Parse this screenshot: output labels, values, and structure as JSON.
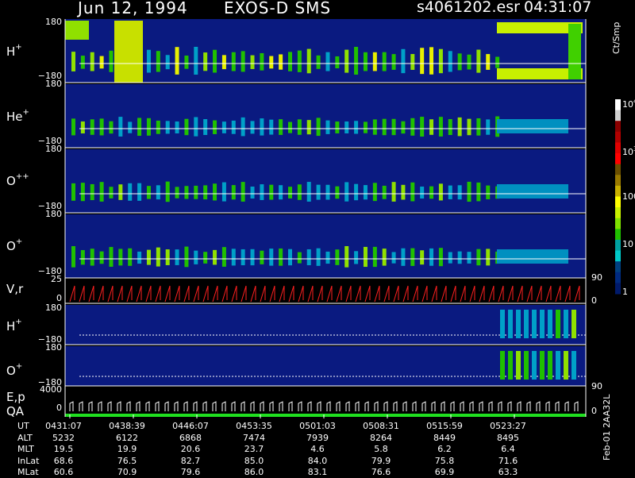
{
  "header": {
    "date": "Jun 12, 1994",
    "instrument": "EXOS-D SMS",
    "file": "s4061202.esr",
    "time": "04:31:07"
  },
  "panel_labels": {
    "p1": {
      "base": "H",
      "sup": "+"
    },
    "p2": {
      "base": "He",
      "sup": "+"
    },
    "p3": {
      "base": "O",
      "sup": "++"
    },
    "p4": {
      "base": "O",
      "sup": "+"
    },
    "p5": {
      "base": "V,r",
      "sup": ""
    },
    "p6": {
      "base": "H",
      "sup": "+"
    },
    "p7": {
      "base": "O",
      "sup": "+"
    },
    "p8": {
      "base": "E,p",
      "sup": ""
    },
    "p9": {
      "base": "QA",
      "sup": ""
    }
  },
  "axis_ticks": {
    "angle_top": "180",
    "angle_bottom": "−180",
    "vr_top": "25",
    "vr_bottom": "0",
    "vr_right_top": "90",
    "vr_right_bottom": "0",
    "ep_top": "4000",
    "ep_bottom": "0",
    "ep_right_top": "90",
    "ep_right_bottom": "0"
  },
  "colorbar": {
    "unit": "Ct/Smp",
    "ticks": [
      {
        "base": "10",
        "sup": "4"
      },
      {
        "base": "10",
        "sup": "3"
      },
      {
        "base": "100",
        "sup": ""
      },
      {
        "base": "10",
        "sup": ""
      },
      {
        "base": "1",
        "sup": ""
      }
    ],
    "colors": [
      "#ffffff",
      "#d0d0d0",
      "#8b0000",
      "#b00000",
      "#e00000",
      "#ff0000",
      "#6b4f00",
      "#9a7a00",
      "#c9b000",
      "#ffff00",
      "#c8f000",
      "#7fe000",
      "#20c000",
      "#00a0a0",
      "#00c8c8",
      "#004080",
      "#002a80",
      "#001a6b"
    ]
  },
  "footer_vertical": "Feb-01 2AA32L",
  "chart_data": {
    "type": "heatmap",
    "title": "Jun 12, 1994 EXOS-D SMS",
    "x_label": "UT",
    "x_ticks": [
      "0431:07",
      "0438:39",
      "0446:07",
      "0453:35",
      "0501:03",
      "0508:31",
      "0515:59",
      "0523:27"
    ],
    "panels": [
      "H+",
      "He+",
      "O++",
      "O+",
      "V,r",
      "H+",
      "O+",
      "E,p",
      "QA"
    ],
    "ylim_angle": [
      -180,
      180
    ],
    "colorbar_range": [
      1,
      10000
    ],
    "colorbar_scale": "log",
    "orbit_table": {
      "rows": [
        {
          "label": "UT",
          "values": [
            "0431:07",
            "0438:39",
            "0446:07",
            "0453:35",
            "0501:03",
            "0508:31",
            "0515:59",
            "0523:27"
          ]
        },
        {
          "label": "ALT",
          "values": [
            "5232",
            "6122",
            "6868",
            "7474",
            "7939",
            "8264",
            "8449",
            "8495"
          ]
        },
        {
          "label": "MLT",
          "values": [
            "19.5",
            "19.9",
            "20.6",
            "23.7",
            "4.6",
            "5.8",
            "6.2",
            "6.4"
          ]
        },
        {
          "label": "InLat",
          "values": [
            "68.6",
            "76.5",
            "82.7",
            "85.0",
            "84.0",
            "79.9",
            "75.8",
            "71.6"
          ]
        },
        {
          "label": "MLat",
          "values": [
            "60.6",
            "70.9",
            "79.6",
            "86.0",
            "83.1",
            "76.6",
            "69.9",
            "63.3"
          ]
        }
      ]
    }
  }
}
